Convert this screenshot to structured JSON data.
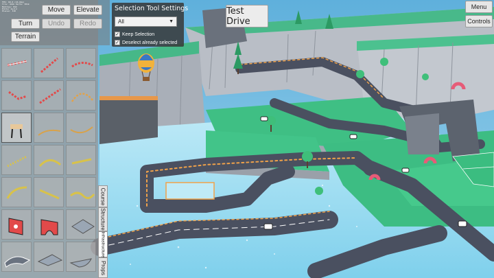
{
  "debug_lines": [
    "FPS: 60.0 (16.6ms)",
    "Tris: 412k Verts: 301k",
    "Batches: 842",
    "Editor build",
    "Pieces: 318"
  ],
  "toolbar": {
    "move_label": "Move",
    "elevate_label": "Elevate",
    "turn_label": "Turn",
    "undo_label": "Undo",
    "redo_label": "Redo",
    "terrain_label": "Terrain"
  },
  "selection_panel": {
    "title": "Selection Tool Settings",
    "filter_value": "All",
    "keep_selection_label": "Keep Selection",
    "keep_selection_checked": true,
    "deselect_label": "Deselect already selected",
    "deselect_checked": true
  },
  "test_drive_label": "Test Drive",
  "menu_label": "Menu",
  "controls_label": "Controls",
  "tabs": [
    {
      "label": "Course",
      "active": false
    },
    {
      "label": "Structure",
      "active": false
    },
    {
      "label": "Infrastructure",
      "active": true
    },
    {
      "label": "Props",
      "active": false
    }
  ],
  "palette": [
    {
      "icon": "road-barrier-straight-icon"
    },
    {
      "icon": "road-barrier-diagonal-icon"
    },
    {
      "icon": "road-barrier-curve-icon"
    },
    {
      "icon": "road-barrier-corner-icon"
    },
    {
      "icon": "road-barrier-diagonal-long-icon"
    },
    {
      "icon": "road-barrier-arc-icon"
    },
    {
      "icon": "barrier-stand-icon"
    },
    {
      "icon": "cable-curve-icon"
    },
    {
      "icon": "cable-arc-icon"
    },
    {
      "icon": "yellow-rail-diagonal-icon"
    },
    {
      "icon": "yellow-rail-arc-icon"
    },
    {
      "icon": "yellow-rail-straight-icon"
    },
    {
      "icon": "yellow-rail-curve-icon"
    },
    {
      "icon": "yellow-rail-slope-icon"
    },
    {
      "icon": "yellow-rail-wave-icon"
    },
    {
      "icon": "red-wall-panel-icon"
    },
    {
      "icon": "red-arch-panel-icon"
    },
    {
      "icon": "grey-floor-tile-icon"
    },
    {
      "icon": "road-ramp-icon"
    },
    {
      "icon": "grey-wedge-icon"
    },
    {
      "icon": "grey-quarter-tile-icon"
    }
  ],
  "colors": {
    "water": "#8fd6ee",
    "grass": "#3fbf84",
    "cliff": "#aab0b8",
    "road": "#4a5060",
    "edge_light": "#f0a24a",
    "barrier_red": "#e24a4a"
  }
}
